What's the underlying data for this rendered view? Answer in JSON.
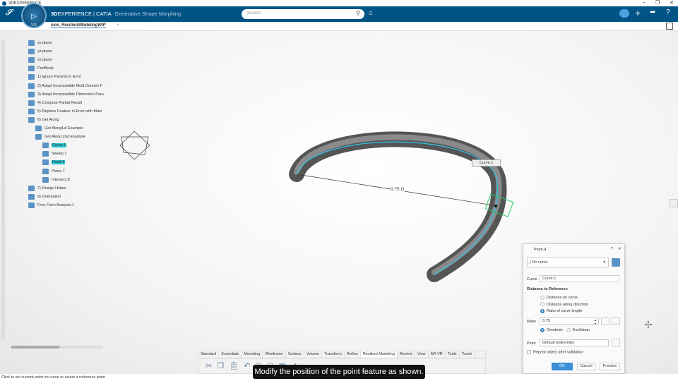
{
  "window": {
    "title": "3DEXPERIENCE",
    "controls": [
      "–",
      "❐",
      "✕"
    ]
  },
  "header": {
    "brand_bold": "3D",
    "brand_rest": "EXPERIENCE | CATIA",
    "app": "Generative Shape Morphing",
    "search_placeholder": "Search",
    "compass_version": "V.R"
  },
  "tab": {
    "label": "nxw_ResilientModelingWIP",
    "add": "+"
  },
  "tree": [
    {
      "label": "xy plane",
      "indent": 0
    },
    {
      "label": "yz plane",
      "indent": 0
    },
    {
      "label": "zx plane",
      "indent": 0
    },
    {
      "label": "PartBody",
      "indent": 0
    },
    {
      "label": "1) Ignore Parents in Error",
      "indent": 0
    },
    {
      "label": "2) Adapt Incompatible Multi Domain F",
      "indent": 0
    },
    {
      "label": "3) Adapt Incompatible Dimension Para",
      "indent": 0
    },
    {
      "label": "4) Compute Partial Result",
      "indent": 0
    },
    {
      "label": "5) Replace Feature in Error with Main",
      "indent": 0
    },
    {
      "label": "6) Get Along",
      "indent": 0
    },
    {
      "label": "Get Along1st Example",
      "indent": 1
    },
    {
      "label": "Get Along 2nd Example",
      "indent": 1
    },
    {
      "label": "Curve.1",
      "indent": 2,
      "highlight": true
    },
    {
      "label": "Sweep.1",
      "indent": 2
    },
    {
      "label": "Point.4",
      "indent": 2,
      "highlight": true
    },
    {
      "label": "Plane.7",
      "indent": 2
    },
    {
      "label": "Intersect.8",
      "indent": 2
    },
    {
      "label": "7) Design Helper",
      "indent": 0
    },
    {
      "label": "8) Orientation",
      "indent": 0
    },
    {
      "label": "Free Form Analysis.1",
      "indent": 0
    }
  ],
  "viewport": {
    "dimension_label": "0.75 G",
    "curve_label": "Curve.1"
  },
  "dialog": {
    "title": "Point.4",
    "type": "On curve",
    "curve_label": "Curve",
    "curve_value": "Curve.1",
    "section": "Distance to Reference",
    "options": [
      "Distance on curve",
      "Distance along direction",
      "Ratio of curve length"
    ],
    "selected_option": 2,
    "ratio_label": "Ratio",
    "ratio_value": "0.75",
    "geodesic": "Geodesic",
    "euclidean": "Euclidean",
    "point_label": "Point",
    "point_value": "Default (extremity)",
    "repeat": "Repeat object after validation",
    "ok": "OK",
    "cancel": "Cancel",
    "preview": "Preview"
  },
  "toolbar": {
    "tabs": [
      "Standard",
      "Essentials",
      "Morphing",
      "Wireframe",
      "Surface",
      "Volume",
      "Transform",
      "Refine",
      "Resilient Modeling",
      "Review",
      "View",
      "AR-VR",
      "Tools",
      "Touch"
    ],
    "active": "Resilient Modeling"
  },
  "caption": "Modify the position of the point feature as shown.",
  "status": "Click to set current point on curve or select a reference point"
}
